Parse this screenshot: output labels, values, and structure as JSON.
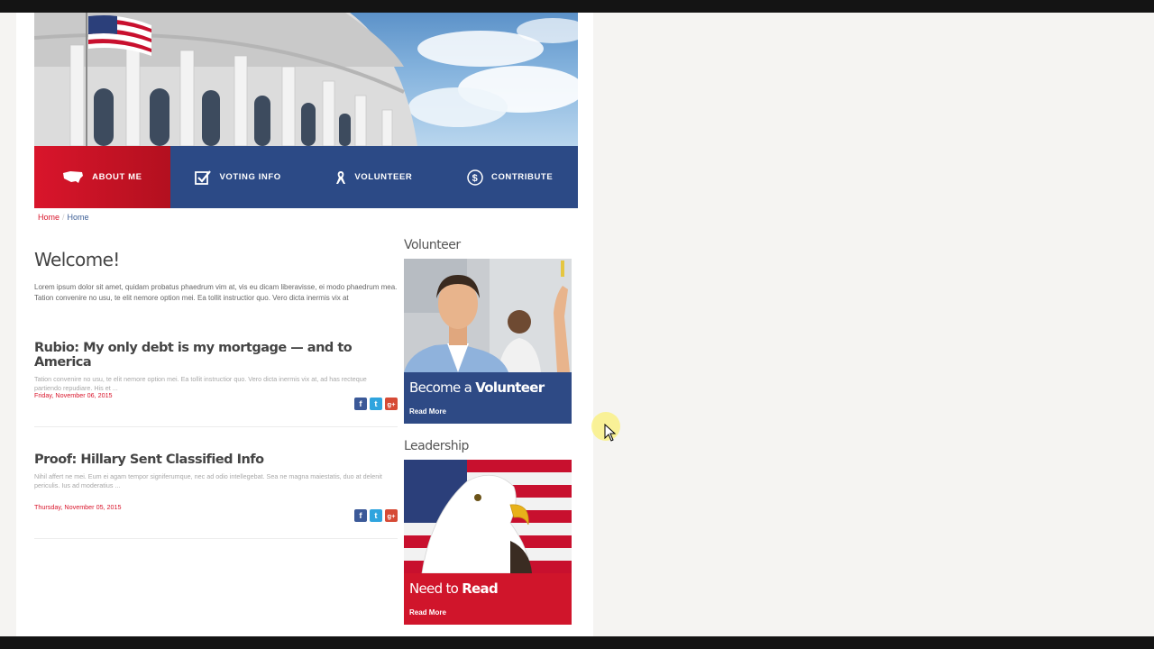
{
  "nav": {
    "items": [
      {
        "label": "ABOUT ME",
        "icon": "usa-map-icon",
        "active": true
      },
      {
        "label": "VOTING INFO",
        "icon": "checkbox-icon",
        "active": false
      },
      {
        "label": "VOLUNTEER",
        "icon": "ribbon-icon",
        "active": false
      },
      {
        "label": "CONTRIBUTE",
        "icon": "dollar-circle-icon",
        "active": false
      }
    ]
  },
  "breadcrumb": {
    "home": "Home",
    "current": "Home"
  },
  "welcome": {
    "title": "Welcome!",
    "text": "Lorem ipsum dolor sit amet, quidam probatus phaedrum vim at, vis eu dicam liberavisse, ei modo phaedrum mea. Tation convenire no usu, te elit nemore option mei. Ea tollit instructior quo. Vero dicta inermis vix at"
  },
  "articles": [
    {
      "title": "Rubio: My only debt is my mortgage — and to America",
      "excerpt": "Tation convenire no usu, te elit nemore option mei. Ea tollit instructior quo. Vero dicta inermis vix at, ad has recteque partiendo repudiare. His et ...",
      "date": "Friday, November 06, 2015"
    },
    {
      "title": "Proof: Hillary Sent Classified Info",
      "excerpt": "Nihil affert ne mei. Eum ei agam tempor signiferumque, nec ad odio intellegebat. Sea ne magna maiestatis, duo at delenit periculis. Ius ad moderatius ...",
      "date": "Thursday, November 05, 2015"
    }
  ],
  "share": {
    "facebook": "f",
    "twitter": "t",
    "google": "g+"
  },
  "sidebar": {
    "volunteer": {
      "title": "Volunteer",
      "head_plain": "Become a ",
      "head_bold": "Volunteer",
      "link": "Read More"
    },
    "leadership": {
      "title": "Leadership",
      "head_plain": "Need to ",
      "head_bold": "Read",
      "link": "Read More"
    }
  },
  "colors": {
    "accent_red": "#d9152b",
    "nav_blue": "#2c4a86"
  }
}
